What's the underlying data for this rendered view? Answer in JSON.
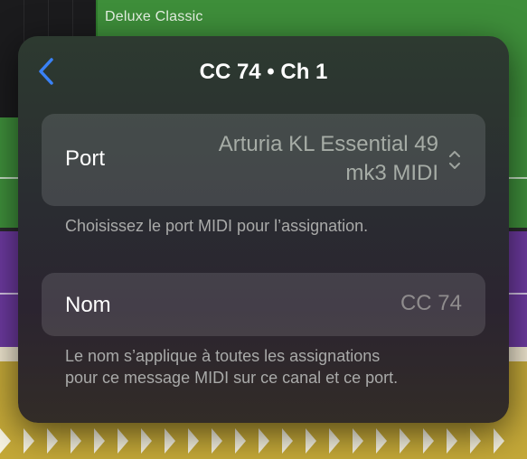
{
  "background": {
    "region_label": "Deluxe Classic"
  },
  "popover": {
    "title": "CC 74 • Ch 1",
    "back_icon": "chevron-left-icon",
    "port": {
      "label": "Port",
      "value_line1": "Arturia KL Essential 49",
      "value_line2": "mk3 MIDI",
      "stepper_icon": "up-down-chevron-icon",
      "help": "Choisissez le port MIDI pour l’assignation."
    },
    "nom": {
      "label": "Nom",
      "placeholder": "CC 74",
      "value": "",
      "help_line1": "Le nom s’applique à toutes les assignations",
      "help_line2": "pour ce message MIDI sur ce canal et ce port."
    }
  },
  "colors": {
    "accent": "#3a82f6",
    "green_track": "#3f8f3b",
    "purple_track": "#6d3aa0",
    "yellow_track": "#c4a838"
  }
}
